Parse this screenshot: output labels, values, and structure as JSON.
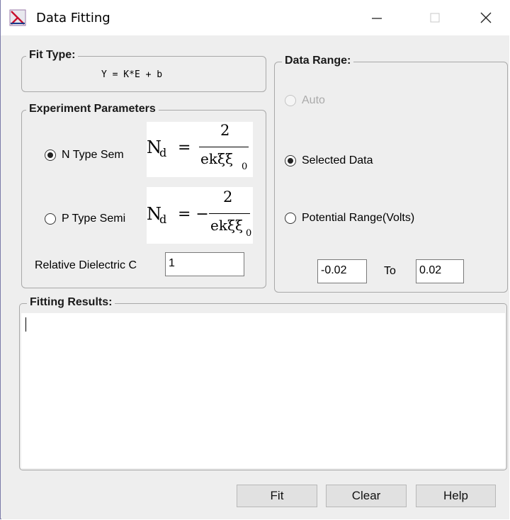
{
  "window": {
    "title": "Data Fitting"
  },
  "fit_type": {
    "legend": "Fit Type:",
    "equation": "Y = K*E + b"
  },
  "experiment": {
    "legend": "Experiment Parameters",
    "n_type_label": "N Type Sem",
    "p_type_label": "P Type Semi",
    "n_formula": {
      "lhs": "N",
      "sub": "d",
      "eq": "=",
      "num": "2",
      "den": "ekξξ",
      "den_sub": "0"
    },
    "p_formula": {
      "lhs": "N",
      "sub": "d",
      "eq": "= −",
      "num": "2",
      "den": "ekξξ",
      "den_sub": "0"
    },
    "dielectric_label": "Relative Dielectric C",
    "dielectric_value": "1"
  },
  "data_range": {
    "legend": "Data Range:",
    "auto_label": "Auto",
    "selected_label": "Selected Data",
    "potential_label": "Potential Range(Volts)",
    "from_value": "-0.02",
    "to_label": "To",
    "to_value": "0.02"
  },
  "results": {
    "legend": "Fitting Results:",
    "text": ""
  },
  "buttons": {
    "fit": "Fit",
    "clear": "Clear",
    "help": "Help"
  },
  "state": {
    "n_type_selected": true,
    "p_type_selected": false,
    "selected_data_checked": true,
    "auto_enabled": false
  }
}
